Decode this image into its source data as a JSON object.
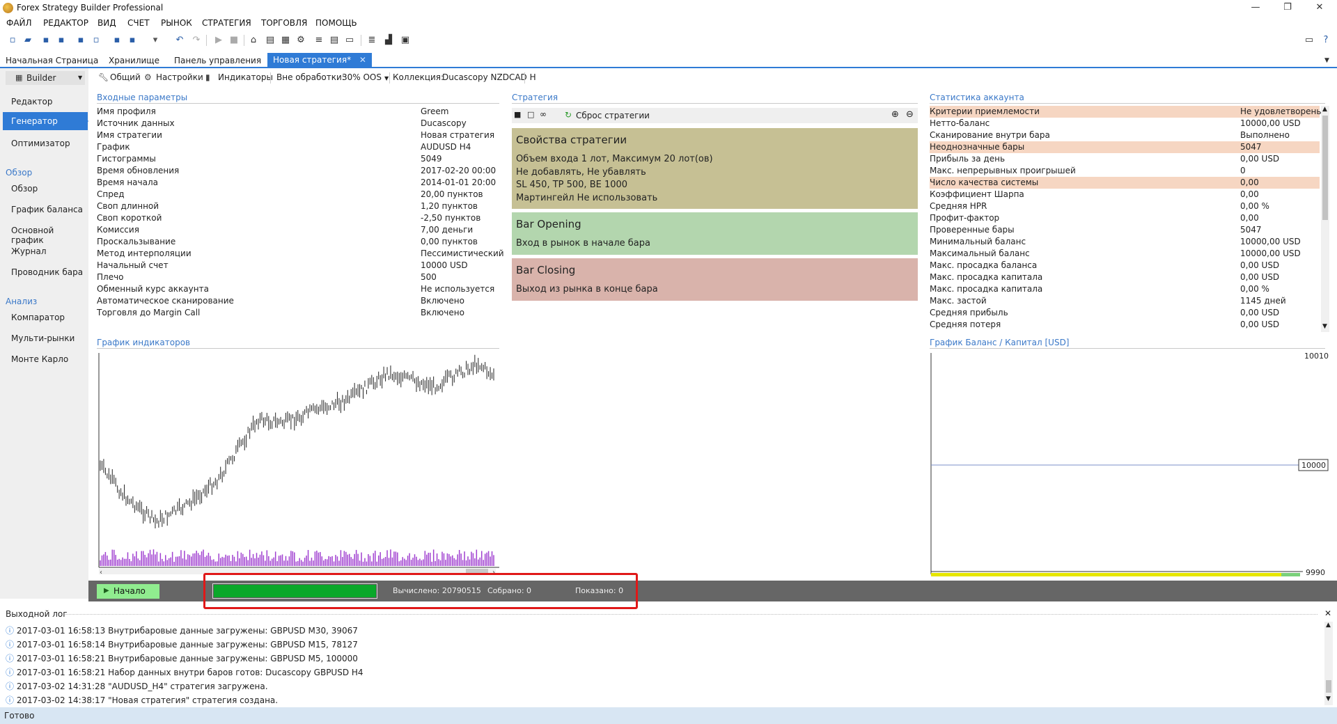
{
  "window": {
    "title": "Forex Strategy Builder Professional",
    "min": "—",
    "max": "❐",
    "close": "✕"
  },
  "menu": [
    "ФАЙЛ",
    "РЕДАКТОР",
    "ВИД",
    "СЧЕТ",
    "РЫНОК",
    "СТРАТЕГИЯ",
    "ТОРГОВЛЯ",
    "ПОМОЩЬ"
  ],
  "tabs": [
    "Начальная Страница",
    "Хранилище",
    "Панель управления",
    "Новая стратегия*"
  ],
  "sidebar": {
    "mode": "Builder",
    "items1": [
      "Редактор",
      "Генератор",
      "Оптимизатор"
    ],
    "group2": "Обзор",
    "items2": [
      "Обзор",
      "График баланса",
      "Основной график",
      "Журнал",
      "Проводник бара"
    ],
    "group3": "Анализ",
    "items3": [
      "Компаратор",
      "Мульти-рынки",
      "Монте Карло"
    ]
  },
  "subbar": {
    "general": "Общий",
    "settings": "Настройки",
    "indicators": "Индикаторы",
    "oos_label": "Вне обработки:",
    "oos_value": "30% OOS",
    "collection_label": "Коллекция:",
    "collection_value": "Ducascopy NZDCAD H"
  },
  "inputs": {
    "heading": "Входные параметры",
    "rows": [
      [
        "Имя профиля",
        "Greem"
      ],
      [
        "Источник данных",
        "Ducascopy"
      ],
      [
        "Имя стратегии",
        "Новая стратегия"
      ],
      [
        "График",
        "AUDUSD H4"
      ],
      [
        "Гистограммы",
        "5049"
      ],
      [
        "Время обновления",
        "2017-02-20 00:00"
      ],
      [
        "Время начала",
        "2014-01-01 20:00"
      ],
      [
        "Спред",
        "20,00 пунктов"
      ],
      [
        "Своп длинной",
        "1,20 пунктов"
      ],
      [
        "Своп короткой",
        "-2,50 пунктов"
      ],
      [
        "Комиссия",
        "7,00 деньги"
      ],
      [
        "Проскальзывание",
        "0,00 пунктов"
      ],
      [
        "Метод интерполяции",
        "Пессимистический"
      ],
      [
        "Начальный счет",
        "10000 USD"
      ],
      [
        "Плечо",
        "500"
      ],
      [
        "Обменный курс аккаунта",
        "Не используется"
      ],
      [
        "Автоматическое сканирование",
        "Включено"
      ],
      [
        "Торговля до Margin Call",
        "Включено"
      ]
    ]
  },
  "strategy": {
    "heading": "Стратегия",
    "reset": "Сброс стратегии",
    "props": {
      "title": "Свойства стратегии",
      "lines": [
        "Объем входа 1 лот, Максимум 20 лот(ов)",
        "Не добавлять, Не убавлять",
        "SL 450,  TP 500,  BE 1000",
        "Мартингейл Не использовать"
      ]
    },
    "opening": {
      "title": "Bar Opening",
      "line": "Вход в рынок в начале бара"
    },
    "closing": {
      "title": "Bar Closing",
      "line": "Выход из рынка в конце бара"
    }
  },
  "stats": {
    "heading": "Статистика аккаунта",
    "rows": [
      [
        "Критерии приемлемости",
        "Не удовлетворены",
        true
      ],
      [
        "Нетто-баланс",
        "10000,00 USD",
        false
      ],
      [
        "Сканирование внутри бара",
        "Выполнено",
        false
      ],
      [
        "Неоднозначные бары",
        "5047",
        true
      ],
      [
        "Прибыль за день",
        "0,00 USD",
        false
      ],
      [
        "Макс. непрерывных проигрышей",
        "0",
        false
      ],
      [
        "Число качества системы",
        "0,00",
        true
      ],
      [
        "Коэффициент Шарпа",
        "0,00",
        false
      ],
      [
        "Средняя HPR",
        "0,00 %",
        false
      ],
      [
        "Профит-фактор",
        "0,00",
        false
      ],
      [
        "Проверенные бары",
        "5047",
        false
      ],
      [
        "Минимальный баланс",
        "10000,00 USD",
        false
      ],
      [
        "Максимальный баланс",
        "10000,00 USD",
        false
      ],
      [
        "Макс. просадка баланса",
        "0,00 USD",
        false
      ],
      [
        "Макс. просадка капитала",
        "0,00 USD",
        false
      ],
      [
        "Макс. просадка капитала",
        "0,00 %",
        false
      ],
      [
        "Макс. застой",
        "1145 дней",
        false
      ],
      [
        "Средняя прибыль",
        "0,00 USD",
        false
      ],
      [
        "Средняя потеря",
        "0,00 USD",
        false
      ]
    ]
  },
  "indicator_chart": {
    "heading": "График индикаторов"
  },
  "balance_chart": {
    "heading": "График Баланс / Капитал [USD]",
    "top": "10010",
    "mid": "10000",
    "bottom": "9990"
  },
  "generator": {
    "start": "Начало",
    "progress": 1.0,
    "computed": "Вычислено: 20790515",
    "collected": "Собрано: 0",
    "shown": "Показано: 0"
  },
  "log": {
    "heading": "Выходной лог",
    "rows": [
      "2017-03-01 16:58:13  Внутрибаровые данные загружены: GBPUSD M30, 39067",
      "2017-03-01 16:58:14  Внутрибаровые данные загружены: GBPUSD M15, 78127",
      "2017-03-01 16:58:21  Внутрибаровые данные загружены: GBPUSD M5, 100000",
      "2017-03-01 16:58:21  Набор данных внутри баров готов: Ducascopy GBPUSD H4",
      "2017-03-02 14:31:28  \"AUDUSD_H4\" стратегия загружена.",
      "2017-03-02 14:38:17  \"Новая стратегия\" стратегия создана."
    ]
  },
  "status": "Готово",
  "colors": {
    "accent": "#2f7bd6",
    "props_bg": "#c6c094",
    "opening_bg": "#b3d6ae",
    "closing_bg": "#d9b3ab",
    "highlight": "#f6d6c2",
    "progress": "#0aa82a",
    "start_btn": "#90ec8f"
  }
}
